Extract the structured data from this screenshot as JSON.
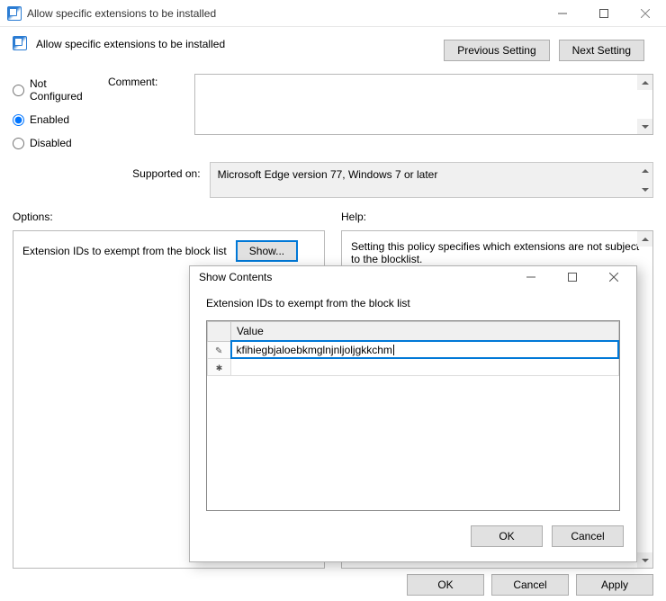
{
  "window": {
    "title": "Allow specific extensions to be installed",
    "heading": "Allow specific extensions to be installed"
  },
  "nav": {
    "previous": "Previous Setting",
    "next": "Next Setting"
  },
  "state": {
    "not_configured": "Not Configured",
    "enabled": "Enabled",
    "disabled": "Disabled",
    "selected": "enabled"
  },
  "comment": {
    "label": "Comment:",
    "value": ""
  },
  "supported": {
    "label": "Supported on:",
    "value": "Microsoft Edge version 77, Windows 7 or later"
  },
  "columns": {
    "options": "Options:",
    "help": "Help:"
  },
  "options": {
    "line_label": "Extension IDs to exempt from the block list",
    "show_button": "Show..."
  },
  "help": {
    "text": "Setting this policy specifies which extensions are not subject to the blocklist."
  },
  "buttons": {
    "ok": "OK",
    "cancel": "Cancel",
    "apply": "Apply"
  },
  "dialog": {
    "title": "Show Contents",
    "subtitle": "Extension IDs to exempt from the block list",
    "column_header": "Value",
    "rows": [
      {
        "marker": "pencil",
        "value": "kfihiegbjaloebkmglnjnljoljgkkchm"
      },
      {
        "marker": "star",
        "value": ""
      }
    ],
    "ok": "OK",
    "cancel": "Cancel"
  }
}
